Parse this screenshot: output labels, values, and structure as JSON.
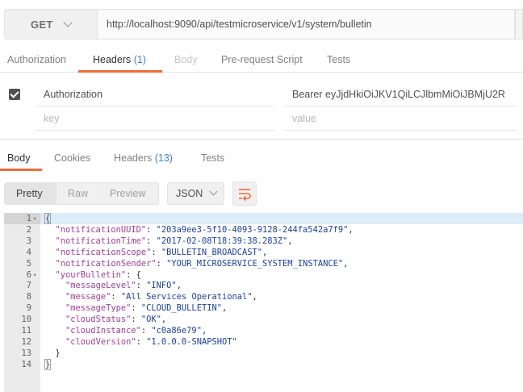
{
  "request": {
    "method": "GET",
    "url": "http://localhost:9090/api/testmicroservice/v1/system/bulletin"
  },
  "request_tabs": [
    {
      "label": "Authorization"
    },
    {
      "label": "Headers",
      "count": "(1)"
    },
    {
      "label": "Body"
    },
    {
      "label": "Pre-request Script"
    },
    {
      "label": "Tests"
    }
  ],
  "headers_table": {
    "rows": [
      {
        "key": "Authorization",
        "value": "Bearer eyJjdHkiOiJKV1QiLCJlbmMiOiJBMjU2R"
      }
    ],
    "key_placeholder": "key",
    "value_placeholder": "value"
  },
  "response_tabs": [
    {
      "label": "Body"
    },
    {
      "label": "Cookies"
    },
    {
      "label": "Headers",
      "count": "(13)"
    },
    {
      "label": "Tests"
    }
  ],
  "view_modes": [
    "Pretty",
    "Raw",
    "Preview"
  ],
  "format": "JSON",
  "colors": {
    "accent": "#f26b3a",
    "count": "#3f7fd1",
    "json_key": "#a23e98",
    "json_string": "#1a3fa8"
  },
  "response_lines": [
    {
      "n": "1",
      "fold": "▾",
      "indent": "",
      "text": "{"
    },
    {
      "n": "2",
      "indent": "  ",
      "key": "\"notificationUUID\"",
      "sep": ": ",
      "val": "\"203a9ee3-5f10-4093-9128-244fa542a7f9\"",
      "end": ","
    },
    {
      "n": "3",
      "indent": "  ",
      "key": "\"notificationTime\"",
      "sep": ": ",
      "val": "\"2017-02-08T18:39:38.283Z\"",
      "end": ","
    },
    {
      "n": "4",
      "indent": "  ",
      "key": "\"notificationScope\"",
      "sep": ": ",
      "val": "\"BULLETIN_BROADCAST\"",
      "end": ","
    },
    {
      "n": "5",
      "indent": "  ",
      "key": "\"notificationSender\"",
      "sep": ": ",
      "val": "\"YOUR_MICROSERVICE_SYSTEM_INSTANCE\"",
      "end": ","
    },
    {
      "n": "6",
      "fold": "▾",
      "indent": "  ",
      "key": "\"yourBulletin\"",
      "sep": ": ",
      "val": "",
      "end": "{"
    },
    {
      "n": "7",
      "indent": "    ",
      "key": "\"messageLevel\"",
      "sep": ": ",
      "val": "\"INFO\"",
      "end": ","
    },
    {
      "n": "8",
      "indent": "    ",
      "key": "\"message\"",
      "sep": ": ",
      "val": "\"All Services Operational\"",
      "end": ","
    },
    {
      "n": "9",
      "indent": "    ",
      "key": "\"messageType\"",
      "sep": ": ",
      "val": "\"CLOUD_BULLETIN\"",
      "end": ","
    },
    {
      "n": "10",
      "indent": "    ",
      "key": "\"cloudStatus\"",
      "sep": ": ",
      "val": "\"OK\"",
      "end": ","
    },
    {
      "n": "11",
      "indent": "    ",
      "key": "\"cloudInstance\"",
      "sep": ": ",
      "val": "\"c0a86e79\"",
      "end": ","
    },
    {
      "n": "12",
      "indent": "    ",
      "key": "\"cloudVersion\"",
      "sep": ": ",
      "val": "\"1.0.0.0-SNAPSHOT\"",
      "end": ""
    },
    {
      "n": "13",
      "indent": "  ",
      "text": "}"
    },
    {
      "n": "14",
      "indent": "",
      "text": "}"
    }
  ]
}
